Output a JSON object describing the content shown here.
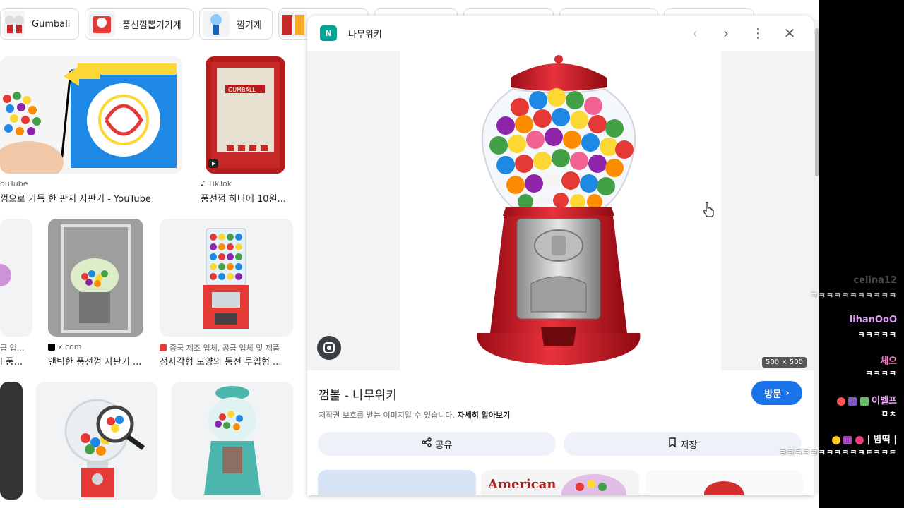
{
  "chips": [
    {
      "label": "Gumball"
    },
    {
      "label": "풍선껌뽑기기계"
    },
    {
      "label": "껌기계"
    }
  ],
  "results": {
    "r1": {
      "src_1": "ouTube",
      "title_1": "껌으로 가득 한 판지 자판기 - YouTube",
      "src_2": "TikTok",
      "title_2": "풍선껌 하나에 10원..."
    },
    "r2": {
      "src_0": "급 업...",
      "title_0": "l 풍...",
      "src_1": "x.com",
      "title_1": "앤틱한 풍선껌 자판기 ...",
      "src_2": "중국 제조 업체, 공급 업체 및 제품",
      "title_2": "정사각형 모양의 동전 투입형 ..."
    }
  },
  "viewer": {
    "site_name": "나무위키",
    "logo_text": "N",
    "dimensions": "500 × 500",
    "title": "껌볼 - 나무위키",
    "visit_label": "방문",
    "copyright_note": "저작권 보호를 받는 이미지일 수 있습니다.",
    "learn_more": "자세히 알아보기",
    "share_label": "공유",
    "save_label": "저장",
    "related_text": "American"
  },
  "chat": [
    {
      "user": "celina12",
      "message": "ㅋㅋㅋㅋㅋㅋㅋㅋㅋㅋㅋ",
      "color": "#8a8a8a"
    },
    {
      "user": "lihanOoO",
      "message": "ㅋㅋㅋㅋㅋ",
      "color": "#d8a0f0"
    },
    {
      "user": "체으",
      "message": "ㅋㅋㅋㅋ",
      "color": "#ff7bd0"
    },
    {
      "user": "이벨프",
      "message": "ㅁㅊ",
      "color": "#f5b0ff"
    },
    {
      "user": "| 밤떡 |",
      "message": "ㅋㅋㅋㅋㅋㅋㅋㅋㅋㅋㅋㅌㅋㅋㅌ",
      "color": "#ffffff"
    }
  ]
}
